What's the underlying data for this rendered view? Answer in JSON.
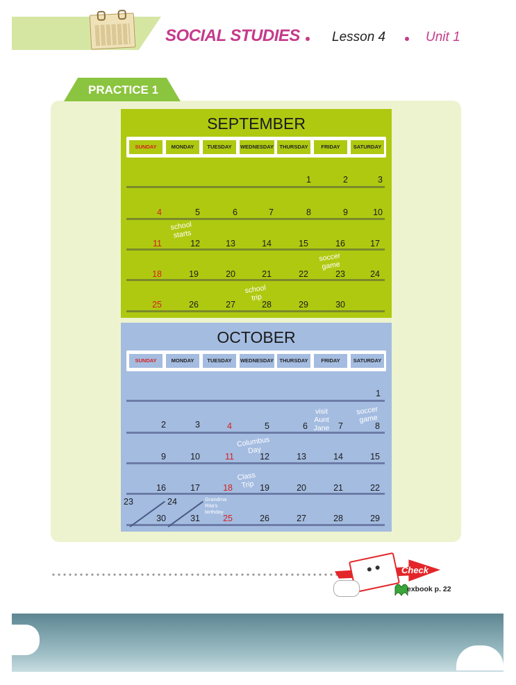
{
  "header": {
    "subject": "SOCIAL STUDIES",
    "lesson": "Lesson 4",
    "unit": "Unit 1"
  },
  "practice": {
    "label": "PRACTICE 1"
  },
  "days": [
    "SUNDAY",
    "MONDAY",
    "TUESDAY",
    "WEDNESDAY",
    "THURSDAY",
    "FRIDAY",
    "SATURDAY"
  ],
  "september": {
    "title": "SEPTEMBER",
    "weeks": [
      [
        "",
        "",
        "",
        "",
        "1",
        "2",
        "3"
      ],
      [
        "4",
        "5",
        "6",
        "7",
        "8",
        "9",
        "10"
      ],
      [
        "11",
        "12",
        "13",
        "14",
        "15",
        "16",
        "17"
      ],
      [
        "18",
        "19",
        "20",
        "21",
        "22",
        "23",
        "24"
      ],
      [
        "25",
        "26",
        "27",
        "28",
        "29",
        "30",
        ""
      ]
    ],
    "notes": {
      "school_starts": "school starts",
      "soccer_game": "soccer game",
      "school_trip": "school trip"
    }
  },
  "october": {
    "title": "OCTOBER",
    "weeks": [
      [
        "",
        "",
        "",
        "",
        "",
        "",
        "1"
      ],
      [
        "2",
        "3",
        "4",
        "5",
        "6",
        "7",
        "8"
      ],
      [
        "9",
        "10",
        "11",
        "12",
        "13",
        "14",
        "15"
      ],
      [
        "16",
        "17",
        "18",
        "19",
        "20",
        "21",
        "22"
      ],
      [
        "30",
        "31",
        "25",
        "26",
        "27",
        "28",
        "29"
      ]
    ],
    "split_top": [
      "23",
      "24"
    ],
    "notes": {
      "visit": "visit Aunt Jane",
      "soccer_game": "soccer game",
      "columbus": "Columbus Day",
      "class_trip": "Class Trip",
      "birthday": "Grandma Rita's birthday"
    }
  },
  "check": {
    "label": "Check",
    "textbook": "exbook p. 22"
  },
  "colors": {
    "september": "#afc911",
    "october": "#a4bce0",
    "accent": "#c63a8a",
    "holiday": "#d6201f"
  }
}
